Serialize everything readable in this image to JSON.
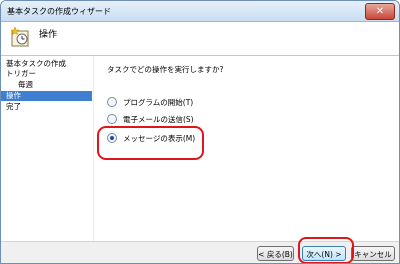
{
  "window": {
    "title": "基本タスクの作成ウィザード",
    "close_label": "✕"
  },
  "header": {
    "title": "操作",
    "icon": "task-clock-icon"
  },
  "sidebar": {
    "items": [
      {
        "label": "基本タスクの作成"
      },
      {
        "label": "トリガー"
      },
      {
        "label": "毎週"
      },
      {
        "label": "操作"
      },
      {
        "label": "完了"
      }
    ]
  },
  "main": {
    "question": "タスクでどの操作を実行しますか?",
    "options": [
      {
        "label": "プログラムの開始(T)",
        "selected": false
      },
      {
        "label": "電子メールの送信(S)",
        "selected": false
      },
      {
        "label": "メッセージの表示(M)",
        "selected": true
      }
    ]
  },
  "footer": {
    "back_label": "< 戻る(B)",
    "next_label": "次へ(N) >",
    "cancel_label": "キャンセル"
  },
  "colors": {
    "highlight": "#e0161a",
    "selection": "#3f7fd1"
  }
}
